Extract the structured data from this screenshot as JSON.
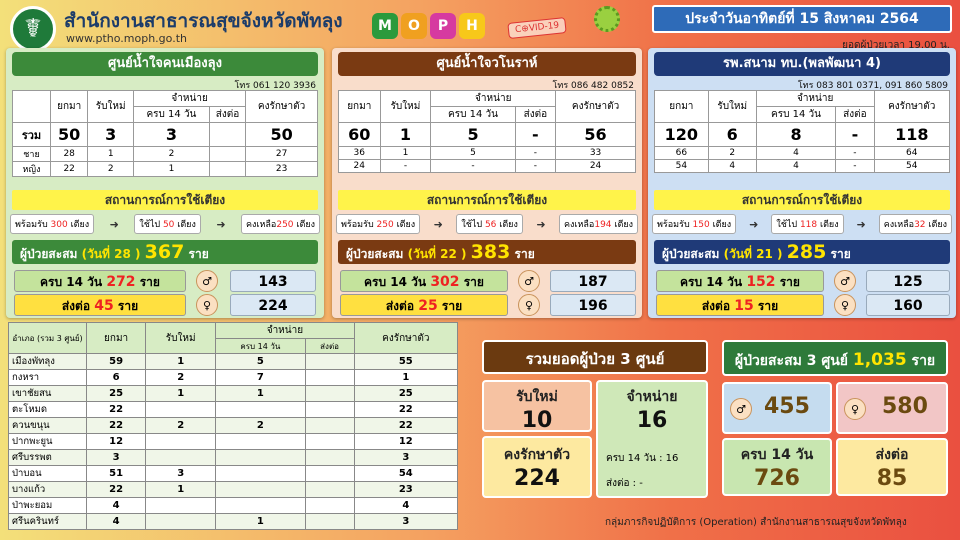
{
  "header": {
    "title": "สำนักงานสาธารณสุขจังหวัดพัทลุง",
    "url": "www.ptho.moph.go.th",
    "moph_letters": [
      "M",
      "O",
      "P",
      "H"
    ],
    "covid_stamp": "C⊕VID-19",
    "date": "ประจำวันอาทิตย์ที่ 15 สิงหาคม 2564",
    "time_note": "ยอดผู้ป่วยเวลา 19.00 น."
  },
  "colors": {
    "green": "#3c8a3a",
    "brown": "#7a3a12",
    "navy": "#1f3a78",
    "yellow": "#fff34a"
  },
  "centers": [
    {
      "name": "ศูนย์น้ำใจคนเมืองลุง",
      "phone": "โทร 061 120 3936",
      "head": {
        "c1": "ยกมา",
        "c2": "รับใหม่",
        "c3": "จำหน่าย",
        "c3a": "ครบ 14 วัน",
        "c3b": "ส่งต่อ",
        "c4": "คงรักษาตัว"
      },
      "rows": [
        {
          "label": "รวม",
          "v": [
            "50",
            "3",
            "3",
            "",
            "50"
          ]
        },
        {
          "label": "ชาย",
          "v": [
            "28",
            "1",
            "2",
            "",
            "27"
          ]
        },
        {
          "label": "หญิง",
          "v": [
            "22",
            "2",
            "1",
            "",
            "23"
          ]
        }
      ],
      "status_title": "สถานการณ์การใช้เตียง",
      "ready_pre": "พร้อมรับ",
      "ready": "300",
      "used_pre": "ใช้ไป",
      "used": "50",
      "left_pre": "คงเหลือ",
      "left": "250",
      "unit": "เตียง",
      "cum_pre": "ผู้ป่วยสะสม",
      "cum_day": "(วันที่ 28 )",
      "cum": "367",
      "cum_unit": "ราย",
      "done_pre": "ครบ 14 วัน",
      "done": "272",
      "ref_pre": "ส่งต่อ",
      "ref": "45",
      "ru": "ราย",
      "male": "143",
      "female": "224"
    },
    {
      "name": "ศูนย์น้ำใจวโนราห์",
      "phone": "โทร 086 482 0852",
      "head": {
        "c1": "ยกมา",
        "c2": "รับใหม่",
        "c3": "จำหน่าย",
        "c3a": "ครบ 14 วัน",
        "c3b": "ส่งต่อ",
        "c4": "คงรักษาตัว"
      },
      "rows": [
        {
          "label": "",
          "v": [
            "60",
            "1",
            "5",
            "-",
            "56"
          ]
        },
        {
          "label": "",
          "v": [
            "36",
            "1",
            "5",
            "-",
            "33"
          ]
        },
        {
          "label": "",
          "v": [
            "24",
            "-",
            "-",
            "-",
            "24"
          ]
        }
      ],
      "status_title": "สถานการณ์การใช้เตียง",
      "ready_pre": "พร้อมรับ",
      "ready": "250",
      "used_pre": "ใช้ไป",
      "used": "56",
      "left_pre": "คงเหลือ",
      "left": "194",
      "unit": "เตียง",
      "cum_pre": "ผู้ป่วยสะสม",
      "cum_day": "(วันที่ 22 )",
      "cum": "383",
      "cum_unit": "ราย",
      "done_pre": "ครบ 14 วัน",
      "done": "302",
      "ref_pre": "ส่งต่อ",
      "ref": "25",
      "ru": "ราย",
      "male": "187",
      "female": "196"
    },
    {
      "name": "รพ.สนาม ทบ.(พลพัฒนา 4)",
      "phone": "โทร 083 801 0371, 091 860 5809",
      "head": {
        "c1": "ยกมา",
        "c2": "รับใหม่",
        "c3": "จำหน่าย",
        "c3a": "ครบ 14 วัน",
        "c3b": "ส่งต่อ",
        "c4": "คงรักษาตัว"
      },
      "rows": [
        {
          "label": "",
          "v": [
            "120",
            "6",
            "8",
            "-",
            "118"
          ]
        },
        {
          "label": "",
          "v": [
            "66",
            "2",
            "4",
            "-",
            "64"
          ]
        },
        {
          "label": "",
          "v": [
            "54",
            "4",
            "4",
            "-",
            "54"
          ]
        }
      ],
      "status_title": "สถานการณ์การใช้เตียง",
      "ready_pre": "พร้อมรับ",
      "ready": "150",
      "used_pre": "ใช้ไป",
      "used": "118",
      "left_pre": "คงเหลือ",
      "left": "32",
      "unit": "เตียง",
      "cum_pre": "ผู้ป่วยสะสม",
      "cum_day": "(วันที่ 21 )",
      "cum": "285",
      "cum_unit": "ราย",
      "done_pre": "ครบ 14 วัน",
      "done": "152",
      "ref_pre": "ส่งต่อ",
      "ref": "15",
      "ru": "ราย",
      "male": "125",
      "female": "160"
    }
  ],
  "district_table": {
    "head": {
      "name": "อำเภอ (รวม 3 ศูนย์)",
      "c1": "ยกมา",
      "c2": "รับใหม่",
      "c3": "จำหน่าย",
      "c3a": "ครบ 14 วัน",
      "c3b": "ส่งต่อ",
      "c4": "คงรักษาตัว"
    },
    "rows": [
      {
        "name": "เมืองพัทลุง",
        "v": [
          "59",
          "1",
          "5",
          "",
          "55"
        ]
      },
      {
        "name": "กงหรา",
        "v": [
          "6",
          "2",
          "7",
          "",
          "1"
        ]
      },
      {
        "name": "เขาชัยสน",
        "v": [
          "25",
          "1",
          "1",
          "",
          "25"
        ]
      },
      {
        "name": "ตะโหมด",
        "v": [
          "22",
          "",
          "",
          "",
          "22"
        ]
      },
      {
        "name": "ควนขนุน",
        "v": [
          "22",
          "2",
          "2",
          "",
          "22"
        ]
      },
      {
        "name": "ปากพะยูน",
        "v": [
          "12",
          "",
          "",
          "",
          "12"
        ]
      },
      {
        "name": "ศรีบรรพต",
        "v": [
          "3",
          "",
          "",
          "",
          "3"
        ]
      },
      {
        "name": "ป่าบอน",
        "v": [
          "51",
          "3",
          "",
          "",
          "54"
        ]
      },
      {
        "name": "บางแก้ว",
        "v": [
          "22",
          "1",
          "",
          "",
          "23"
        ]
      },
      {
        "name": "ป่าพะยอม",
        "v": [
          "4",
          "",
          "",
          "",
          "4"
        ]
      },
      {
        "name": "ศรีนครินทร์",
        "v": [
          "4",
          "",
          "1",
          "",
          "3"
        ]
      }
    ]
  },
  "summary": {
    "title": "รวมยอดผู้ป่วย 3 ศูนย์",
    "new_label": "รับใหม่",
    "new": "10",
    "disch_label": "จำหน่าย",
    "disch": "16",
    "remain_label": "คงรักษาตัว",
    "remain": "224",
    "disch_14": "ครบ 14 วัน  : 16",
    "disch_ref": "ส่งต่อ : -"
  },
  "cumulative3": {
    "title_pre": "ผู้ป่วยสะสม 3 ศูนย์",
    "total": "1,035",
    "unit": "ราย",
    "male": "455",
    "female": "580",
    "done_label": "ครบ 14 วัน",
    "done": "726",
    "ref_label": "ส่งต่อ",
    "ref": "85"
  },
  "footer": "กลุ่มภารกิจปฏิบัติการ (Operation) สำนักงานสาธารณสุขจังหวัดพัทลุง"
}
